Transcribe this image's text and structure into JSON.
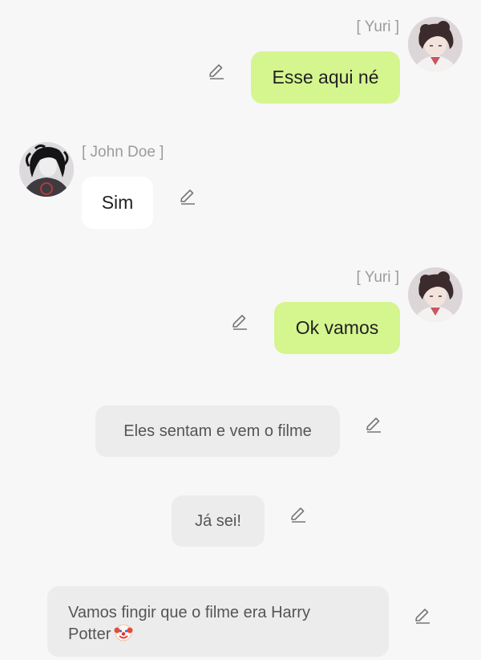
{
  "messages": [
    {
      "sender": "[ Yuri ]",
      "text": "Esse aqui né",
      "side": "right",
      "style": "user-bubble"
    },
    {
      "sender": "[ John Doe ]",
      "text": "Sim",
      "side": "left",
      "style": "character-bubble"
    },
    {
      "sender": "[ Yuri ]",
      "text": "Ok vamos",
      "side": "right",
      "style": "user-bubble"
    },
    {
      "text": "Eles sentam e vem o filme",
      "style": "narration"
    },
    {
      "text": "Já sei!",
      "style": "narration"
    },
    {
      "text": "Vamos fingir que o filme era Harry Potter",
      "emoji": "clown-face",
      "style": "narration"
    }
  ],
  "icons": {
    "edit": "pencil-edit-icon",
    "avatar_yuri": "yuri-avatar",
    "avatar_john": "john-doe-avatar"
  },
  "colors": {
    "background": "#f7f7f7",
    "user_bubble": "#d5f58f",
    "character_bubble": "#ffffff",
    "narration_bubble": "#ececec",
    "sender_name": "#9b9b9b"
  }
}
